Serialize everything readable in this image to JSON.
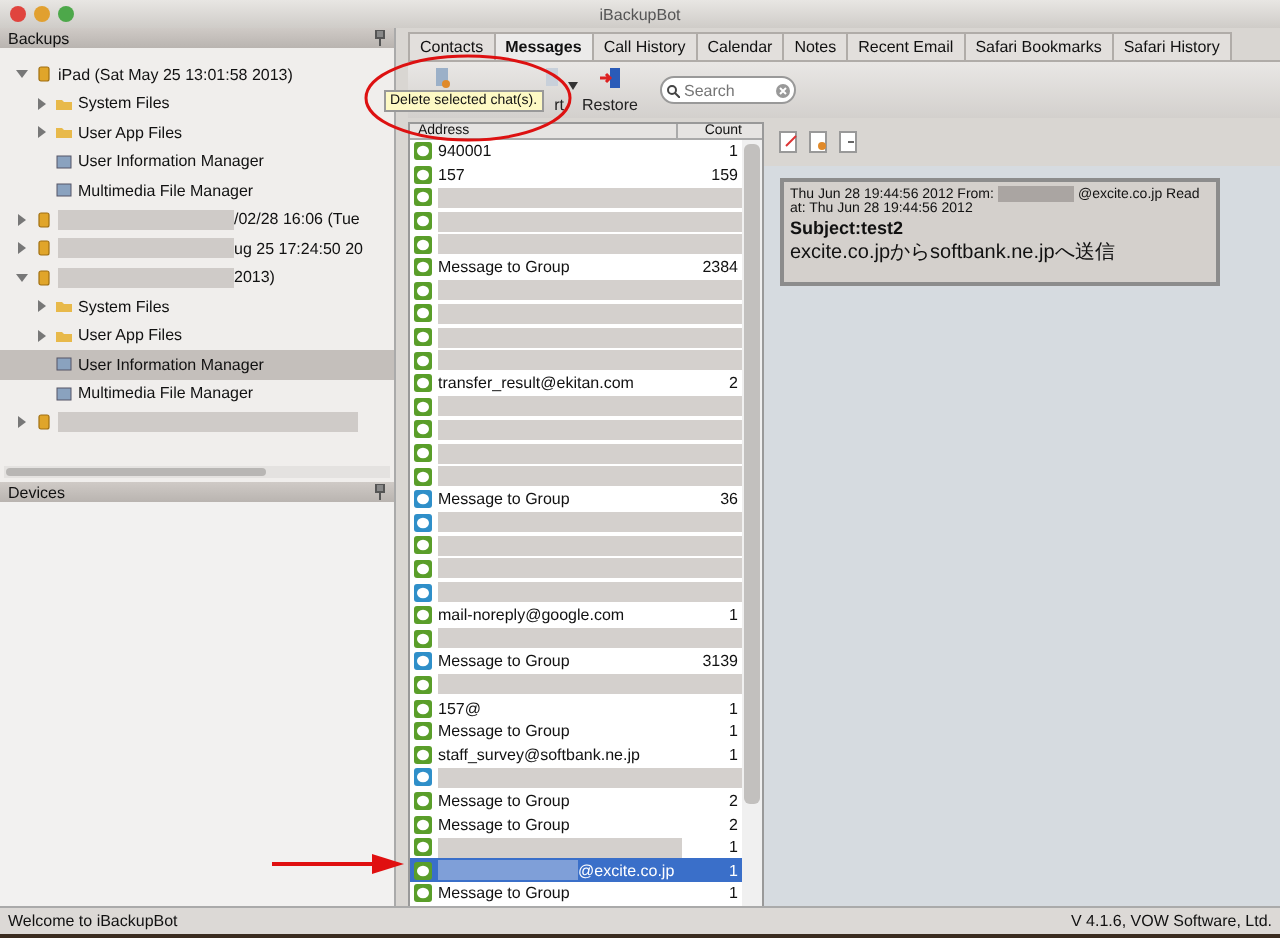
{
  "window": {
    "title": "iBackupBot"
  },
  "backups": {
    "title": "Backups",
    "tree": [
      {
        "label": "iPad (Sat May 25 13:01:58 2013)",
        "kind": "device",
        "expanded": true,
        "selected": false,
        "children": [
          {
            "label": "System Files",
            "kind": "folder",
            "expanded": false,
            "selected": false
          },
          {
            "label": "User App Files",
            "kind": "folder",
            "expanded": false,
            "selected": false
          },
          {
            "label": "User Information Manager",
            "kind": "app",
            "selected": false
          },
          {
            "label": "Multimedia File Manager",
            "kind": "app",
            "selected": false
          }
        ]
      },
      {
        "label": "/02/28 16:06 (Tue",
        "kind": "device",
        "redacted": true,
        "expanded": false,
        "selected": false
      },
      {
        "label": "ug 25 17:24:50 20",
        "kind": "device",
        "redacted": true,
        "expanded": false,
        "selected": false
      },
      {
        "label": "2013)",
        "kind": "device",
        "redacted": true,
        "expanded": true,
        "selected": false,
        "children": [
          {
            "label": "System Files",
            "kind": "folder",
            "expanded": false,
            "selected": false
          },
          {
            "label": "User App Files",
            "kind": "folder",
            "expanded": false,
            "selected": false
          },
          {
            "label": "User Information Manager",
            "kind": "app",
            "selected": true
          },
          {
            "label": "Multimedia File Manager",
            "kind": "app",
            "selected": false
          }
        ]
      },
      {
        "kind": "device",
        "redacted": true,
        "expanded": false,
        "selected": false
      }
    ]
  },
  "devices": {
    "title": "Devices"
  },
  "tabs": [
    {
      "label": "Contacts",
      "selected": false
    },
    {
      "label": "Messages",
      "selected": true
    },
    {
      "label": "Call History",
      "selected": false
    },
    {
      "label": "Calendar",
      "selected": false
    },
    {
      "label": "Notes",
      "selected": false
    },
    {
      "label": "Recent Email",
      "selected": false
    },
    {
      "label": "Safari Bookmarks",
      "selected": false
    },
    {
      "label": "Safari History",
      "selected": false
    }
  ],
  "toolbar": {
    "buttons": [
      {
        "kind": "delete"
      },
      {
        "kind": "export",
        "label": "rt"
      },
      {
        "kind": "restore",
        "label": "Restore"
      }
    ],
    "search": {
      "placeholder": "Search"
    },
    "tooltip": "Delete selected chat(s)."
  },
  "messages": {
    "columns": [
      "Address",
      "Count"
    ],
    "rows": [
      {
        "address": "940001",
        "count": "1",
        "redacted": false,
        "selected": false,
        "color": "#5a9e2a"
      },
      {
        "address": "157",
        "count": "159",
        "redacted": false,
        "selected": false,
        "color": "#5a9e2a"
      },
      {
        "redacted": true,
        "selected": false,
        "color": "#5a9e2a"
      },
      {
        "redacted": true,
        "selected": false,
        "color": "#5a9e2a"
      },
      {
        "redacted": true,
        "selected": false,
        "color": "#5a9e2a"
      },
      {
        "address": "Message to Group",
        "count": "2384",
        "redacted": false,
        "selected": false,
        "color": "#5a9e2a"
      },
      {
        "redacted": true,
        "selected": false,
        "color": "#5a9e2a"
      },
      {
        "redacted": true,
        "selected": false,
        "color": "#5a9e2a"
      },
      {
        "redacted": true,
        "selected": false,
        "color": "#5a9e2a"
      },
      {
        "redacted": true,
        "selected": false,
        "color": "#5a9e2a"
      },
      {
        "address": "transfer_result@ekitan.com",
        "count": "2",
        "redacted": false,
        "selected": false,
        "color": "#5a9e2a"
      },
      {
        "redacted": true,
        "selected": false,
        "color": "#5a9e2a"
      },
      {
        "redacted": true,
        "selected": false,
        "color": "#5a9e2a"
      },
      {
        "redacted": true,
        "selected": false,
        "color": "#5a9e2a"
      },
      {
        "redacted": true,
        "selected": false,
        "color": "#5a9e2a"
      },
      {
        "address": "Message to Group",
        "count": "36",
        "redacted": false,
        "selected": false,
        "color": "#2f8fc9"
      },
      {
        "redacted": true,
        "selected": false,
        "color": "#2f8fc9"
      },
      {
        "redacted": true,
        "selected": false,
        "color": "#5a9e2a"
      },
      {
        "redacted": true,
        "selected": false,
        "color": "#5a9e2a"
      },
      {
        "redacted": true,
        "selected": false,
        "color": "#2f8fc9"
      },
      {
        "address": "mail-noreply@google.com",
        "count": "1",
        "redacted": false,
        "selected": false,
        "color": "#5a9e2a"
      },
      {
        "redacted": true,
        "selected": false,
        "color": "#5a9e2a"
      },
      {
        "address": "Message to Group",
        "count": "3139",
        "redacted": false,
        "selected": false,
        "color": "#2f8fc9"
      },
      {
        "redacted": true,
        "selected": false,
        "color": "#5a9e2a"
      },
      {
        "address": "157@",
        "count": "1",
        "redacted": false,
        "selected": false,
        "color": "#5a9e2a"
      },
      {
        "address": "Message to Group",
        "count": "1",
        "redacted": false,
        "selected": false,
        "color": "#5a9e2a"
      },
      {
        "address": "staff_survey@softbank.ne.jp",
        "count": "1",
        "redacted": false,
        "selected": false,
        "color": "#5a9e2a"
      },
      {
        "redacted": true,
        "selected": false,
        "color": "#2f8fc9"
      },
      {
        "address": "Message to Group",
        "count": "2",
        "redacted": false,
        "selected": false,
        "color": "#5a9e2a"
      },
      {
        "address": "Message to Group",
        "count": "2",
        "redacted": false,
        "selected": false,
        "color": "#5a9e2a"
      },
      {
        "count": "1",
        "redacted": true,
        "selected": false,
        "color": "#5a9e2a"
      },
      {
        "address": "@excite.co.jp",
        "count": "1",
        "redacted": true,
        "selected": true,
        "color": "#5a9e2a"
      },
      {
        "address": "Message to Group",
        "count": "1",
        "redacted": false,
        "selected": false,
        "color": "#5a9e2a"
      }
    ]
  },
  "preview": {
    "from_line": "Thu Jun 28 19:44:56 2012 From:",
    "sender": "@excite.co.jp Read",
    "sender_redacted": true,
    "read_line": "at: Thu Jun 28 19:44:56 2012",
    "subject": "Subject:test2",
    "body": "excite.co.jpからsoftbank.ne.jpへ送信"
  },
  "status_bar": {
    "message": "Welcome to iBackupBot",
    "version": "V 4.1.6, VOW Software, Ltd."
  }
}
